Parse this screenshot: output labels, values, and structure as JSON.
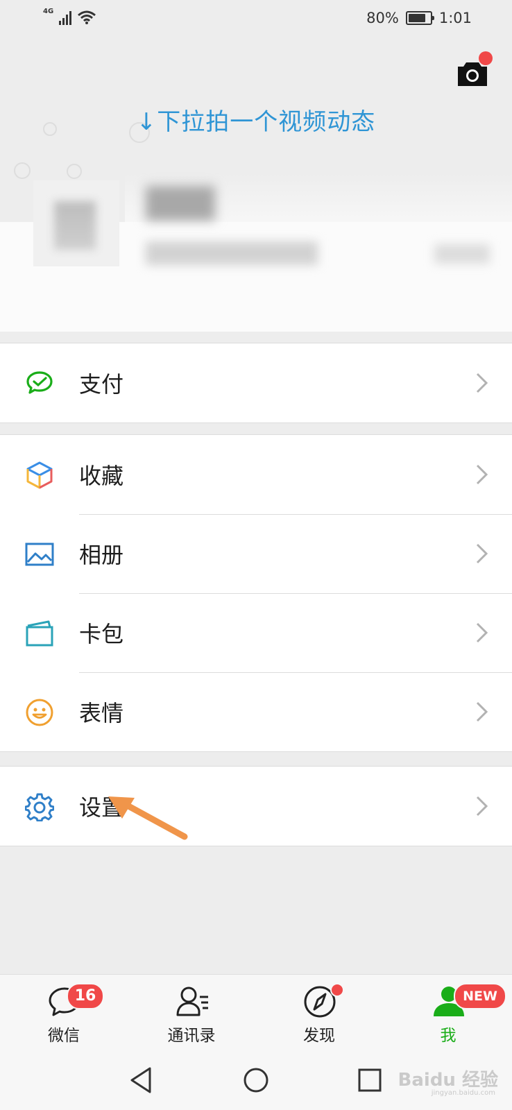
{
  "status_bar": {
    "network": "4G",
    "battery": "80%",
    "battery_level": 0.8,
    "time": "1:01"
  },
  "header": {
    "pull_hint": "↓下拉拍一个视频动态",
    "camera_icon": "camera-icon"
  },
  "menu": {
    "groups": [
      {
        "items": [
          {
            "label": "支付",
            "icon": "pay-icon"
          }
        ]
      },
      {
        "items": [
          {
            "label": "收藏",
            "icon": "favorites-icon"
          },
          {
            "label": "相册",
            "icon": "album-icon"
          },
          {
            "label": "卡包",
            "icon": "card-wallet-icon"
          },
          {
            "label": "表情",
            "icon": "sticker-icon"
          }
        ]
      },
      {
        "items": [
          {
            "label": "设置",
            "icon": "gear-icon"
          }
        ]
      }
    ]
  },
  "tabbar": {
    "tabs": [
      {
        "label": "微信",
        "badge": "16",
        "icon": "chat-icon"
      },
      {
        "label": "通讯录",
        "icon": "contacts-icon"
      },
      {
        "label": "发现",
        "icon": "compass-icon"
      },
      {
        "label": "我",
        "badge": "NEW",
        "icon": "me-icon",
        "active": true
      }
    ]
  },
  "watermark": {
    "text": "Baidu 经验",
    "sub": "jingyan.baidu.com"
  },
  "colors": {
    "accent_blue": "#2f95d5",
    "wechat_green": "#1aad19",
    "badge_red": "#f04848",
    "arrow_orange": "#f0954a"
  }
}
